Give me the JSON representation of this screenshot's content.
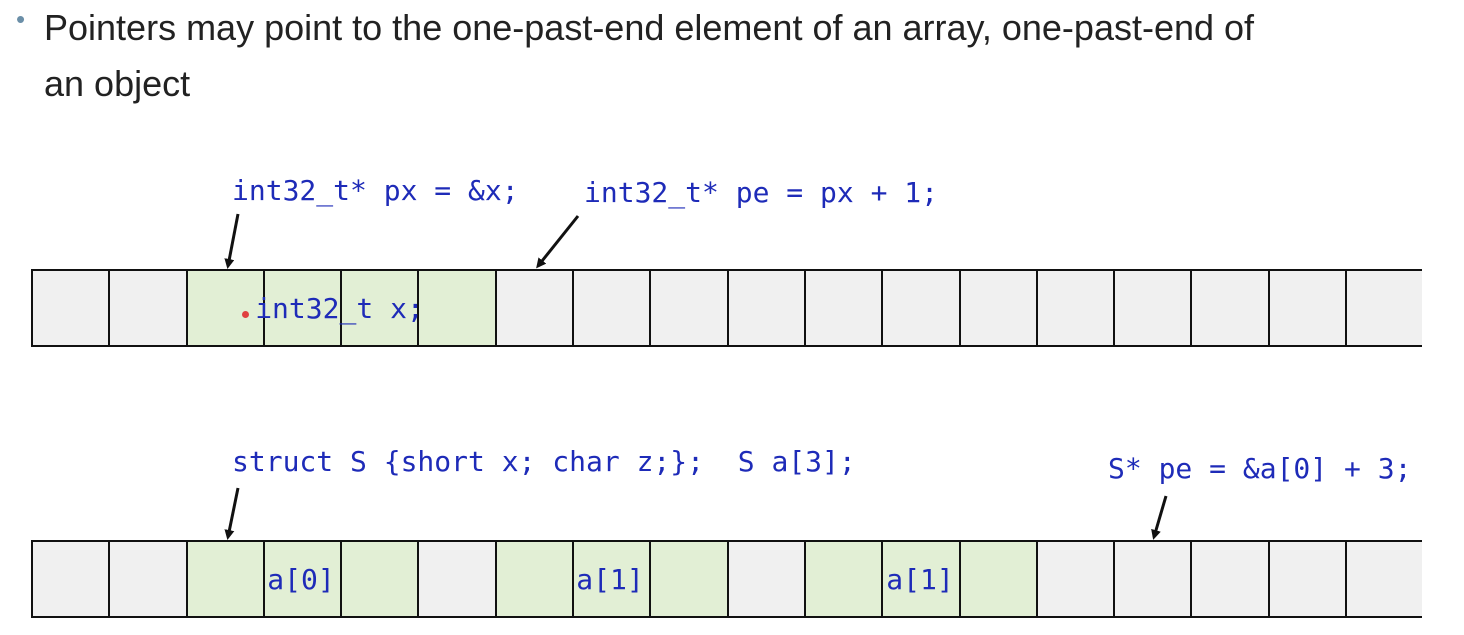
{
  "slide": {
    "bullet": "•",
    "heading_line1": "Pointers may point to the one-past-end element of an array, one-past-end of",
    "heading_line2": "an object"
  },
  "diagram1": {
    "label_px": "int32_t* px = &x;",
    "label_pe": "int32_t* pe = px + 1;",
    "object_label": "int32_t x;",
    "cell_count": 18
  },
  "diagram2": {
    "label_struct": "struct S {short x; char z;};  S a[3];",
    "label_pe": "S* pe = &a[0] + 3;",
    "element_labels": [
      "a[0]",
      "a[1]",
      "a[1]"
    ],
    "cell_count": 18
  },
  "colors": {
    "highlight": "#e2efd5",
    "cell": "#f0f0f0",
    "code": "#1e2bb8",
    "text": "#222222"
  }
}
